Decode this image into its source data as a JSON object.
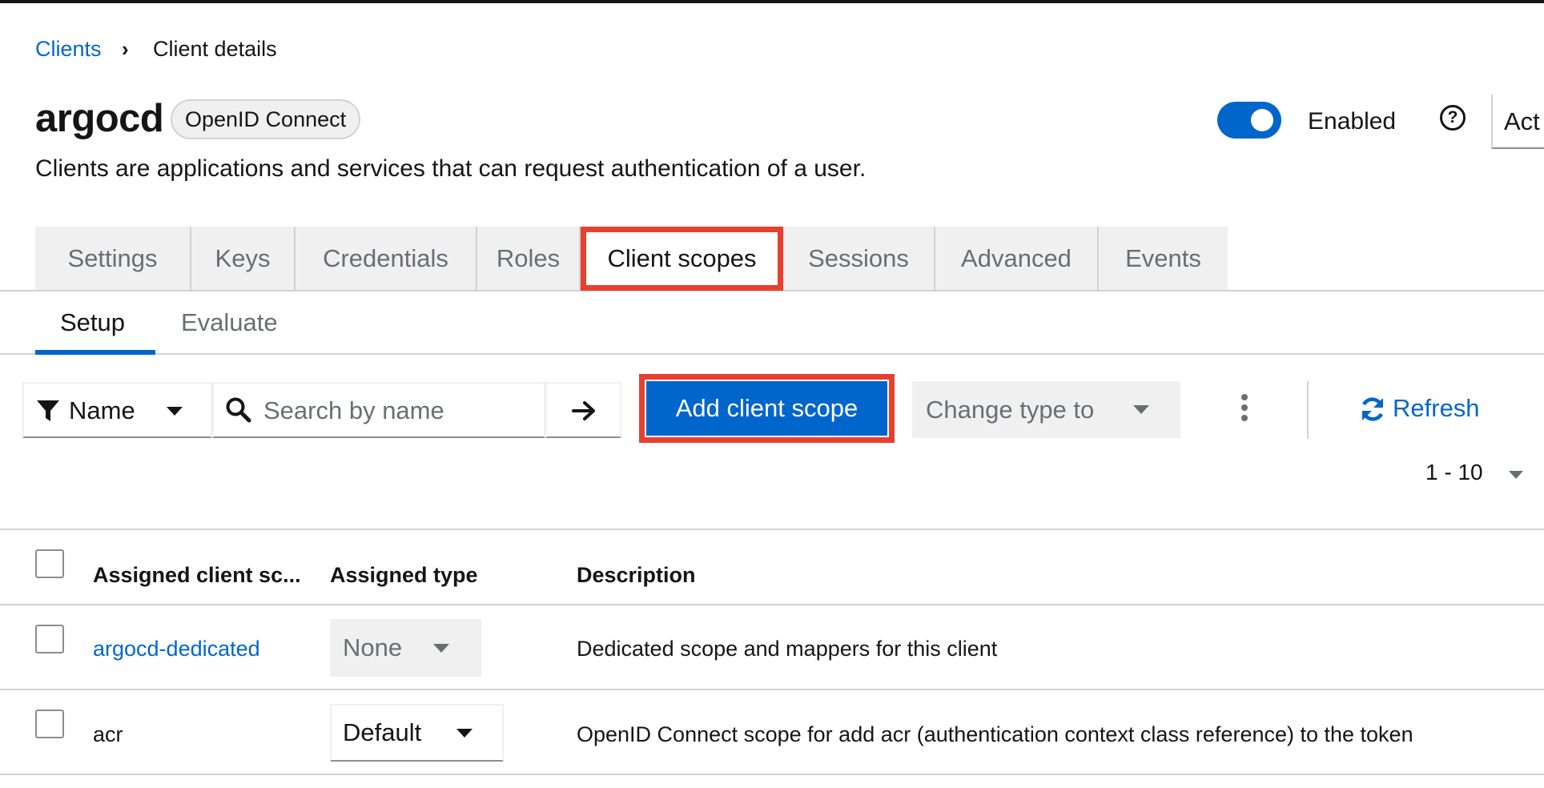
{
  "breadcrumb": {
    "parent": "Clients",
    "separator": "›",
    "current": "Client details"
  },
  "header": {
    "title": "argocd",
    "protocol_badge": "OpenID Connect",
    "subtitle": "Clients are applications and services that can request authentication of a user.",
    "enabled_label": "Enabled",
    "enabled": true,
    "help_glyph": "?",
    "action_label": "Act"
  },
  "tabs": [
    {
      "label": "Settings",
      "active": false
    },
    {
      "label": "Keys",
      "active": false
    },
    {
      "label": "Credentials",
      "active": false
    },
    {
      "label": "Roles",
      "active": false
    },
    {
      "label": "Client scopes",
      "active": true
    },
    {
      "label": "Sessions",
      "active": false
    },
    {
      "label": "Advanced",
      "active": false
    },
    {
      "label": "Events",
      "active": false
    }
  ],
  "subtabs": [
    {
      "label": "Setup",
      "active": true
    },
    {
      "label": "Evaluate",
      "active": false
    }
  ],
  "toolbar": {
    "filter_label": "Name",
    "search_placeholder": "Search by name",
    "add_scope_label": "Add client scope",
    "change_type_label": "Change type to",
    "refresh_label": "Refresh"
  },
  "pagination": {
    "range": "1 - 10"
  },
  "table": {
    "headers": [
      "Assigned client sc...",
      "Assigned type",
      "Description"
    ],
    "rows": [
      {
        "name": "argocd-dedicated",
        "is_link": true,
        "type": "None",
        "type_disabled": true,
        "description": "Dedicated scope and mappers for this client"
      },
      {
        "name": "acr",
        "is_link": false,
        "type": "Default",
        "type_disabled": false,
        "description": "OpenID Connect scope for add acr (authentication context class reference) to the token"
      }
    ]
  },
  "colors": {
    "accent": "#0066cc",
    "highlight": "#e8402f",
    "tab_bg": "#f0f0f0",
    "text": "#151515",
    "muted": "#6a6e73"
  }
}
